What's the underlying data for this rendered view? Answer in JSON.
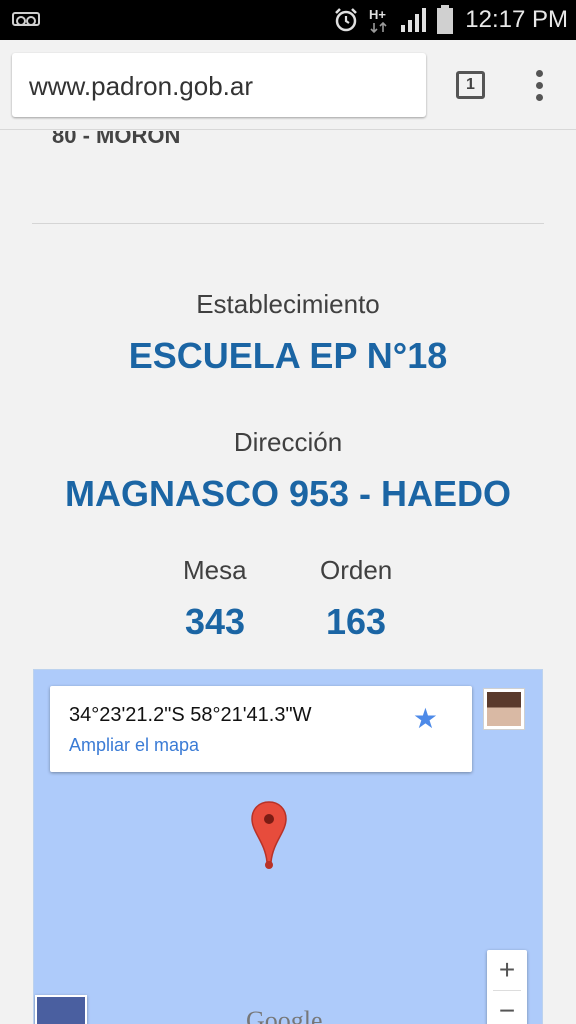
{
  "statusbar": {
    "time": "12:17 PM",
    "network": "H+",
    "icons": [
      "voicemail-icon",
      "alarm-icon",
      "network-type-icon",
      "signal-icon",
      "battery-icon"
    ]
  },
  "browser": {
    "url": "www.padron.gob.ar",
    "tab_count": "1"
  },
  "page": {
    "partial_heading": "80 - MORON",
    "establecimiento_label": "Establecimiento",
    "establecimiento_value": "ESCUELA EP N°18",
    "direccion_label": "Dirección",
    "direccion_value": "MAGNASCO 953 - HAEDO",
    "mesa_label": "Mesa",
    "mesa_value": "343",
    "orden_label": "Orden",
    "orden_value": "163"
  },
  "map": {
    "coordinates": "34°23'21.2\"S 58°21'41.3\"W",
    "enlarge_link": "Ampliar el mapa",
    "zoom_in": "+",
    "zoom_out": "−",
    "watermark": "Google",
    "colors": {
      "water": "#aecbfa",
      "pin": "#e74c3c",
      "link": "#3a7bd5",
      "star": "#4d8ae8"
    }
  },
  "colors": {
    "accent": "#1b65a4",
    "status_bar": "#000000",
    "background": "#f2f2f2"
  }
}
